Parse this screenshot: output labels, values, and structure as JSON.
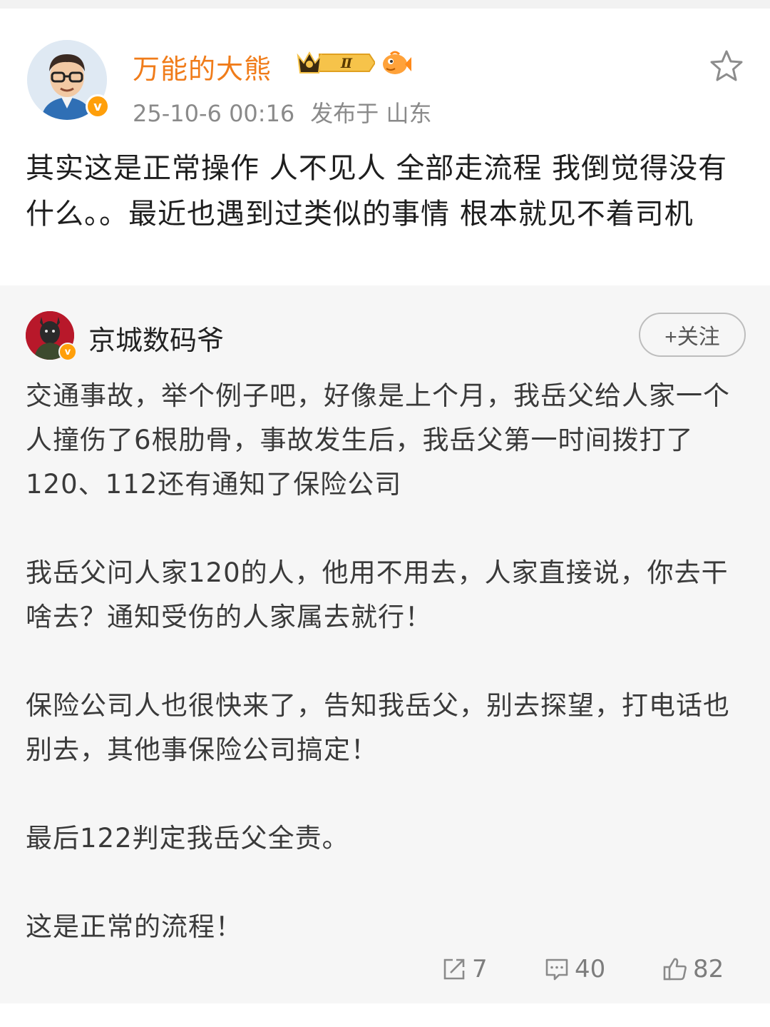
{
  "post": {
    "author": "万能的大熊",
    "level_badge": "Ⅱ",
    "verify_mark": "v",
    "timestamp": "25-10-6 00:16",
    "location": "发布于 山东",
    "body": "其实这是正常操作 人不见人 全部走流程 我倒觉得没有什么。。最近也遇到过类似的事情 根本就见不着司机"
  },
  "quoted": {
    "author": "京城数码爷",
    "verify_mark": "v",
    "follow_label": "+关注",
    "paragraphs": [
      "交通事故，举个例子吧，好像是上个月，我岳父给人家一个人撞伤了6根肋骨，事故发生后，我岳父第一时间拨打了120、112还有通知了保险公司",
      "我岳父问人家120的人，他用不用去，人家直接说，你去干啥去？通知受伤的人家属去就行！",
      "保险公司人也很快来了，告知我岳父，别去探望，打电话也别去，其他事保险公司搞定！",
      "最后122判定我岳父全责。",
      "这是正常的流程！"
    ],
    "actions": {
      "repost_count": "7",
      "comment_count": "40",
      "like_count": "82"
    }
  },
  "colors": {
    "author_accent": "#f07c1a",
    "verify_orange": "#ff9f0a",
    "quote_background": "#f6f6f6",
    "meta_gray": "#8a8a8a"
  },
  "icons": [
    "star-icon",
    "crown-badge-icon",
    "fish-badge-icon",
    "repost-icon",
    "comment-icon",
    "like-icon"
  ]
}
